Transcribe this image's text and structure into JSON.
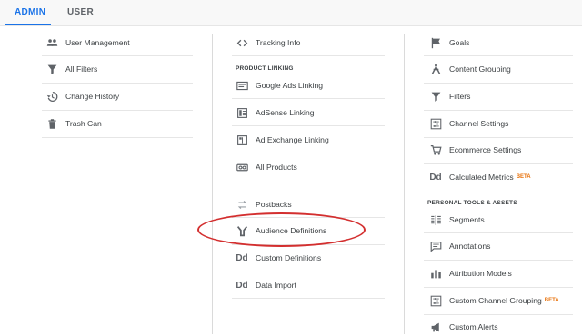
{
  "tabs": {
    "admin": "ADMIN",
    "user": "USER"
  },
  "col1": {
    "user_management": "User Management",
    "all_filters": "All Filters",
    "change_history": "Change History",
    "trash_can": "Trash Can"
  },
  "col2": {
    "tracking_info": "Tracking Info",
    "section_product_linking": "PRODUCT LINKING",
    "google_ads_linking": "Google Ads Linking",
    "adsense_linking": "AdSense Linking",
    "ad_exchange_linking": "Ad Exchange Linking",
    "all_products": "All Products",
    "postbacks": "Postbacks",
    "audience_definitions": "Audience Definitions",
    "custom_definitions": "Custom Definitions",
    "data_import": "Data Import",
    "dd_glyph": "Dd"
  },
  "col3": {
    "goals": "Goals",
    "content_grouping": "Content Grouping",
    "filters": "Filters",
    "channel_settings": "Channel Settings",
    "ecommerce_settings": "Ecommerce Settings",
    "calculated_metrics": "Calculated Metrics",
    "beta": "BETA",
    "section_personal": "PERSONAL TOOLS & ASSETS",
    "segments": "Segments",
    "annotations": "Annotations",
    "attribution_models": "Attribution Models",
    "custom_channel_grouping": "Custom Channel Grouping",
    "custom_alerts": "Custom Alerts",
    "dd_glyph": "Dd"
  },
  "colors": {
    "accent": "#1a73e8",
    "highlight": "#d32f2f",
    "beta": "#e8710a"
  }
}
